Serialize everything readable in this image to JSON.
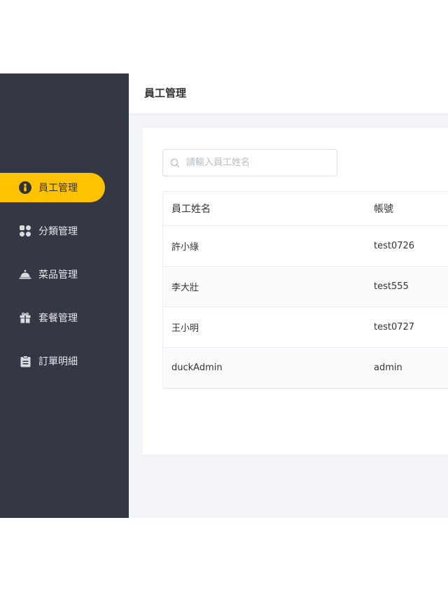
{
  "sidebar": {
    "items": [
      {
        "label": "員工管理",
        "icon": "employee-icon",
        "active": true
      },
      {
        "label": "分類管理",
        "icon": "category-grid-icon",
        "active": false
      },
      {
        "label": "菜品管理",
        "icon": "dish-bell-icon",
        "active": false
      },
      {
        "label": "套餐管理",
        "icon": "gift-icon",
        "active": false
      },
      {
        "label": "訂單明細",
        "icon": "clipboard-icon",
        "active": false
      }
    ]
  },
  "header": {
    "title": "員工管理"
  },
  "search": {
    "placeholder": "請輸入員工姓名",
    "value": ""
  },
  "table": {
    "columns": [
      "員工姓名",
      "帳號"
    ],
    "rows": [
      {
        "name": "許小綠",
        "account": "test0726"
      },
      {
        "name": "李大壯",
        "account": "test555"
      },
      {
        "name": "王小明",
        "account": "test0727"
      },
      {
        "name": "duckAdmin",
        "account": "admin"
      }
    ]
  },
  "colors": {
    "sidebar_bg": "#343744",
    "accent": "#ffc200",
    "page_bg": "#f3f4f7"
  }
}
